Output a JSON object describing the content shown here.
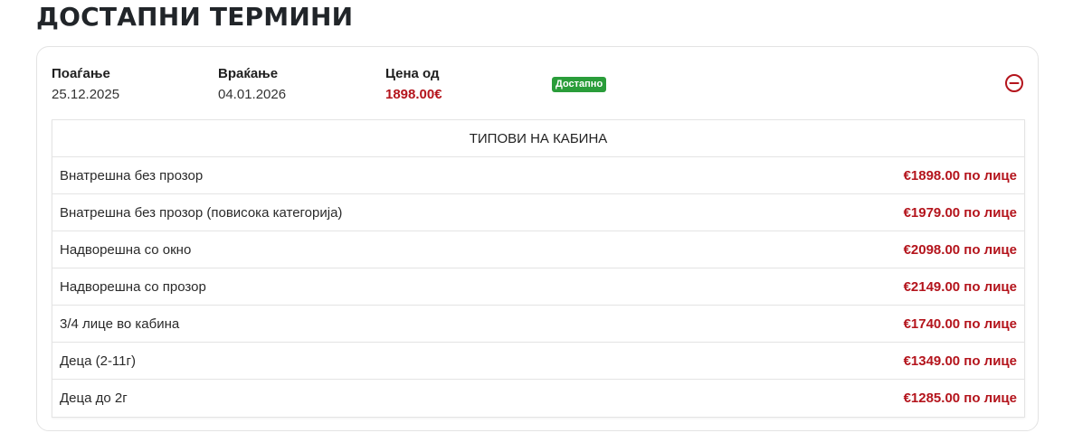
{
  "page": {
    "title": "ДОСТАПНИ ТЕРМИНИ"
  },
  "term": {
    "departure_label": "Поаѓање",
    "departure_date": "25.12.2025",
    "return_label": "Враќање",
    "return_date": "04.01.2026",
    "price_label": "Цена од",
    "price_value": "1898.00€",
    "status_badge": "Достапно",
    "collapse_icon": "minus-circle-icon"
  },
  "cabins": {
    "header": "ТИПОВИ НА КАБИНА",
    "rows": [
      {
        "name": "Внатрешна без прозор",
        "price": "€1898.00 по лице"
      },
      {
        "name": "Внатрешна без прозор (повисока категорија)",
        "price": "€1979.00 по лице"
      },
      {
        "name": "Надворешна со окно",
        "price": "€2098.00 по лице"
      },
      {
        "name": "Надворешна со прозор",
        "price": "€2149.00 по лице"
      },
      {
        "name": "3/4 лице во кабина",
        "price": "€1740.00 по лице"
      },
      {
        "name": "Деца (2-11г)",
        "price": "€1349.00 по лице"
      },
      {
        "name": "Деца до 2г",
        "price": "€1285.00 по лице"
      }
    ]
  },
  "colors": {
    "accent_red": "#b4141c",
    "badge_green": "#2a9d3a",
    "border": "#e4e4e4"
  }
}
